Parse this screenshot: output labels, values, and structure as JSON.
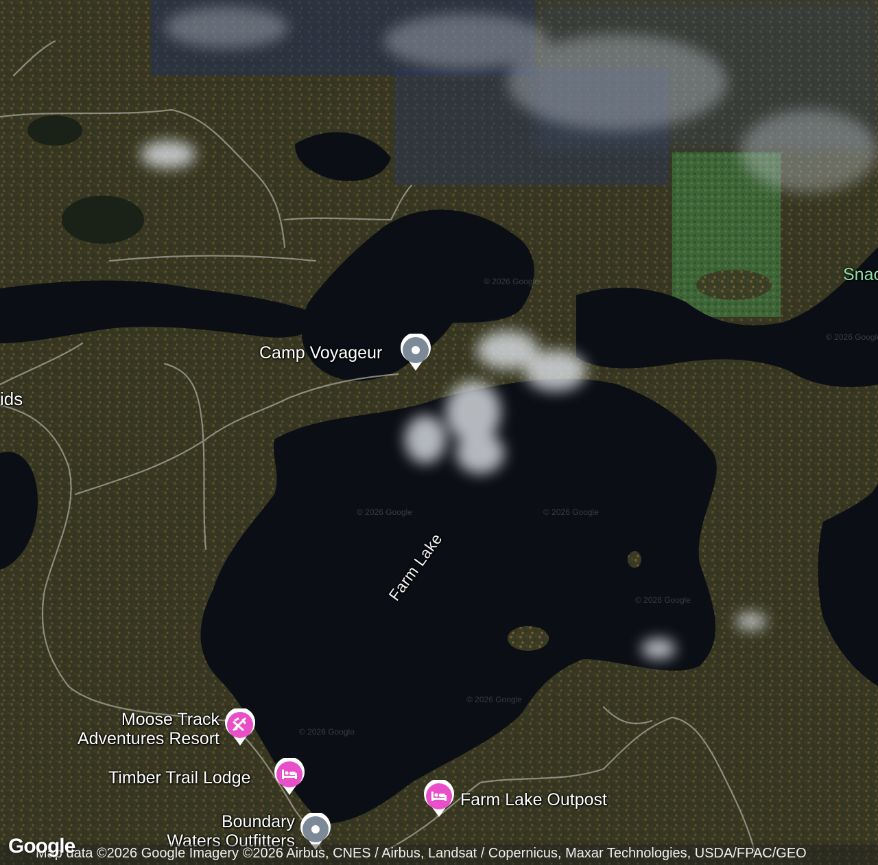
{
  "map": {
    "lake_label": "Farm Lake",
    "partial_labels": {
      "left_edge": "ids",
      "right_edge": "Snac"
    },
    "watermark": "© 2026 Google",
    "places": [
      {
        "name": "Camp Voyageur",
        "category": "landmark",
        "icon": "place-dot-icon",
        "color": "#7b8a96"
      },
      {
        "name": "Moose Track Adventures Resort",
        "lines": [
          "Moose Track",
          "Adventures Resort"
        ],
        "category": "resort",
        "icon": "activity-icon",
        "color": "#e94fc8"
      },
      {
        "name": "Timber Trail Lodge",
        "category": "lodging",
        "icon": "bed-icon",
        "color": "#e94fc8"
      },
      {
        "name": "Farm Lake Outpost",
        "category": "lodging",
        "icon": "bed-icon",
        "color": "#e94fc8"
      },
      {
        "name": "Boundary Waters Outfitters",
        "lines": [
          "Boundary",
          "Waters Outfitters"
        ],
        "category": "landmark",
        "icon": "place-dot-icon",
        "color": "#7b8a96"
      }
    ]
  },
  "footer": {
    "logo": "Google",
    "attribution": "Map data ©2026 Google Imagery ©2026 Airbus, CNES / Airbus, Landsat / Copernicus, Maxar Technologies, USDA/FPAC/GEO"
  }
}
